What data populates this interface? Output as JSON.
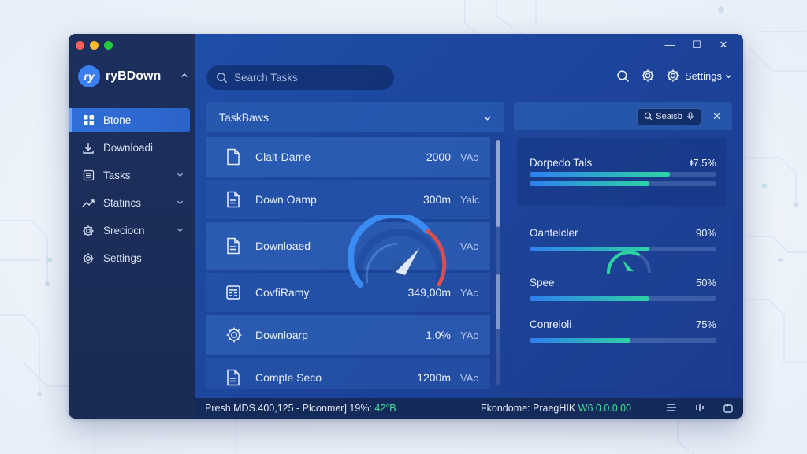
{
  "window": {
    "brand_logo": "ry",
    "brand_name": "ryBDown",
    "controls": {
      "minimize": "—",
      "maximize": "☐",
      "close": "✕"
    }
  },
  "sidebar": {
    "items": [
      {
        "label": "Btone",
        "icon": "grid-icon",
        "active": true,
        "chevron": false
      },
      {
        "label": "Downloadi",
        "icon": "download-icon",
        "active": false,
        "chevron": false
      },
      {
        "label": "Tasks",
        "icon": "list-icon",
        "active": false,
        "chevron": true
      },
      {
        "label": "Statincs",
        "icon": "chart-line-icon",
        "active": false,
        "chevron": true
      },
      {
        "label": "Sreciocn",
        "icon": "gear-icon",
        "active": false,
        "chevron": true
      },
      {
        "label": "Settings",
        "icon": "gear-icon",
        "active": false,
        "chevron": false
      }
    ]
  },
  "header": {
    "search_placeholder": "Search Tasks",
    "settings_label": "Settings"
  },
  "tasks": {
    "title": "TaskBaws",
    "rows": [
      {
        "name": "Clalt-Dame",
        "size": "2000",
        "unit": "VAc",
        "icon": "file-icon"
      },
      {
        "name": "Down Oamp",
        "size": "300m",
        "unit": "Yalc",
        "icon": "file-text-icon"
      },
      {
        "name": "Downloaed",
        "size": "",
        "unit": "VAc",
        "icon": "file-text-icon"
      },
      {
        "name": "CovfiRamy",
        "size": "349,00m",
        "unit": "YAc",
        "icon": "calculator-icon"
      },
      {
        "name": "Downloarp",
        "size": "1.0%",
        "unit": "YAc",
        "icon": "gear-icon"
      },
      {
        "name": "Comple Seco",
        "size": "1200m",
        "unit": "VAc",
        "icon": "file-text-icon"
      }
    ]
  },
  "right_panel": {
    "search_label": "Seaisb",
    "close": "✕",
    "stats": [
      {
        "label": "Dorpedo Tals",
        "value": "ᵵ7.5%",
        "fill": 0.75
      },
      {
        "label": "Oantelcler",
        "value": "90%",
        "fill": 0.64
      },
      {
        "label": "Spee",
        "value": "50%",
        "fill": 0.64
      },
      {
        "label": "Conreloli",
        "value": "75%",
        "fill": 0.54
      }
    ]
  },
  "statusbar": {
    "left_text": "Presh MDS.400,125 - Plconmer] 19%: ",
    "left_green": "42°B",
    "mid_text": "Fkondome: PraegHIK ",
    "mid_green": "W6 0.0.0.00"
  },
  "colors": {
    "accent": "#2f6fd9",
    "progress_start": "#2f7ff0",
    "progress_end": "#2ed3a4",
    "gauge_red": "#d8504f",
    "status_green": "#3fe39b"
  }
}
